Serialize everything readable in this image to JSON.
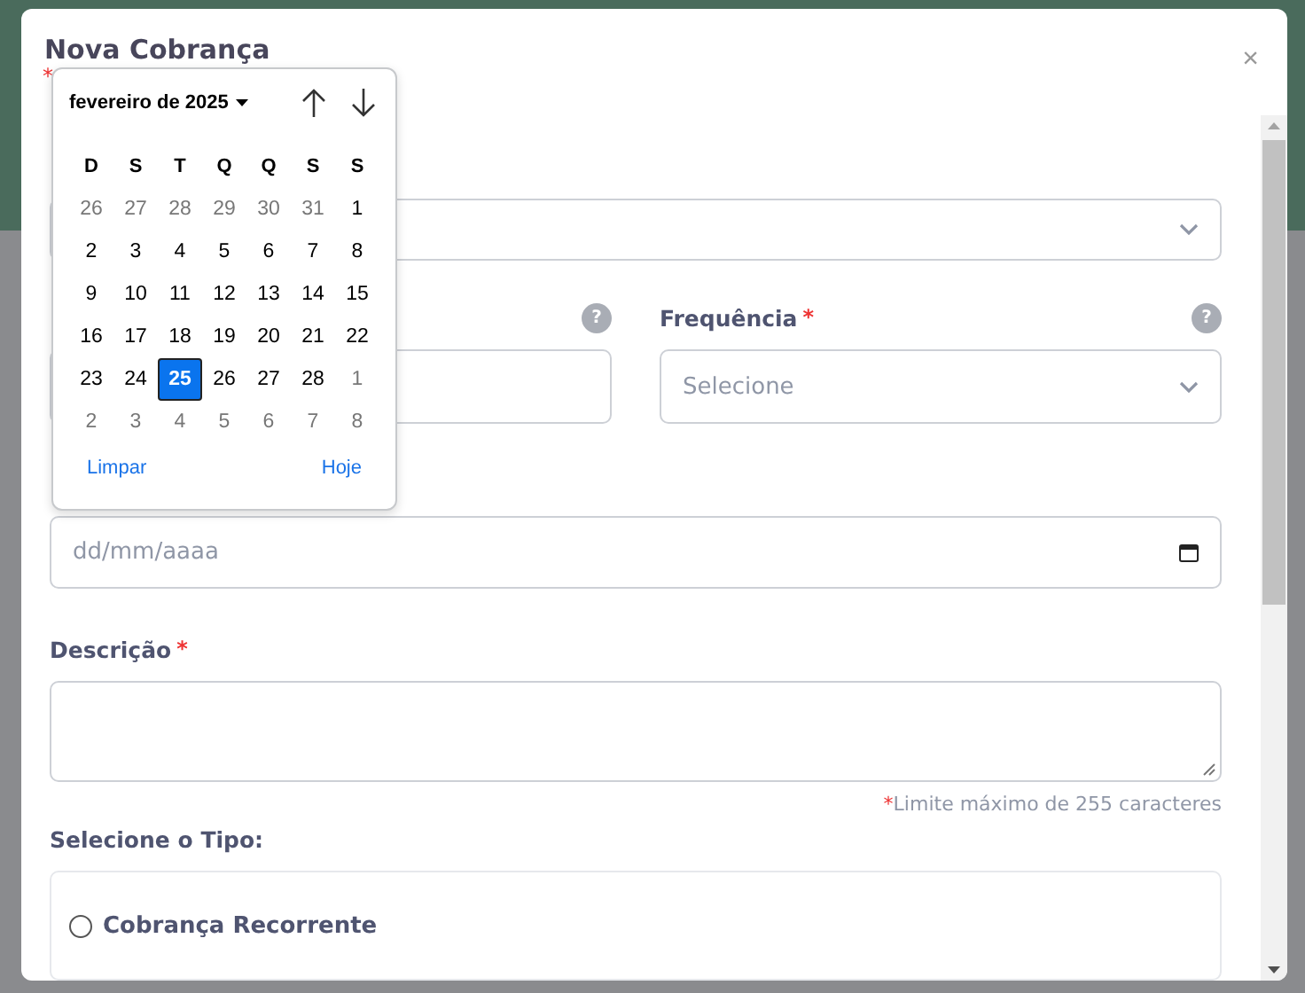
{
  "modal": {
    "title": "Nova Cobrança",
    "required_note": "*",
    "close": "×"
  },
  "fields": [
    {
      "kind": "select"
    },
    {
      "kind": "row",
      "children": [
        {
          "kind": "input",
          "help": "?"
        },
        {
          "kind": "select",
          "label": "Frequência",
          "required_mark": "*",
          "help": "?",
          "value": "Selecione"
        }
      ]
    },
    {
      "kind": "date",
      "placeholder": "dd/mm/aaaa"
    },
    {
      "kind": "textarea",
      "label": "Descrição",
      "required_mark": "*",
      "hint": "Limite máximo de 255 caracteres",
      "hint_mark": "*"
    }
  ],
  "type_section": {
    "label": "Selecione o Tipo:",
    "options": [
      {
        "label": "Cobrança Recorrente",
        "selected": false
      }
    ]
  },
  "datepicker": {
    "month": "fevereiro de 2025",
    "weekdays": [
      "D",
      "S",
      "T",
      "Q",
      "Q",
      "S",
      "S"
    ],
    "weeks": [
      [
        {
          "day": "26",
          "muted": true,
          "selected": false
        },
        {
          "day": "27",
          "muted": true,
          "selected": false
        },
        {
          "day": "28",
          "muted": true,
          "selected": false
        },
        {
          "day": "29",
          "muted": true,
          "selected": false
        },
        {
          "day": "30",
          "muted": true,
          "selected": false
        },
        {
          "day": "31",
          "muted": true,
          "selected": false
        },
        {
          "day": "1",
          "muted": false,
          "selected": false
        }
      ],
      [
        {
          "day": "2",
          "muted": false,
          "selected": false
        },
        {
          "day": "3",
          "muted": false,
          "selected": false
        },
        {
          "day": "4",
          "muted": false,
          "selected": false
        },
        {
          "day": "5",
          "muted": false,
          "selected": false
        },
        {
          "day": "6",
          "muted": false,
          "selected": false
        },
        {
          "day": "7",
          "muted": false,
          "selected": false
        },
        {
          "day": "8",
          "muted": false,
          "selected": false
        }
      ],
      [
        {
          "day": "9",
          "muted": false,
          "selected": false
        },
        {
          "day": "10",
          "muted": false,
          "selected": false
        },
        {
          "day": "11",
          "muted": false,
          "selected": false
        },
        {
          "day": "12",
          "muted": false,
          "selected": false
        },
        {
          "day": "13",
          "muted": false,
          "selected": false
        },
        {
          "day": "14",
          "muted": false,
          "selected": false
        },
        {
          "day": "15",
          "muted": false,
          "selected": false
        }
      ],
      [
        {
          "day": "16",
          "muted": false,
          "selected": false
        },
        {
          "day": "17",
          "muted": false,
          "selected": false
        },
        {
          "day": "18",
          "muted": false,
          "selected": false
        },
        {
          "day": "19",
          "muted": false,
          "selected": false
        },
        {
          "day": "20",
          "muted": false,
          "selected": false
        },
        {
          "day": "21",
          "muted": false,
          "selected": false
        },
        {
          "day": "22",
          "muted": false,
          "selected": false
        }
      ],
      [
        {
          "day": "23",
          "muted": false,
          "selected": false
        },
        {
          "day": "24",
          "muted": false,
          "selected": false
        },
        {
          "day": "25",
          "muted": false,
          "selected": true
        },
        {
          "day": "26",
          "muted": false,
          "selected": false
        },
        {
          "day": "27",
          "muted": false,
          "selected": false
        },
        {
          "day": "28",
          "muted": false,
          "selected": false
        },
        {
          "day": "1",
          "muted": true,
          "selected": false
        }
      ],
      [
        {
          "day": "2",
          "muted": true,
          "selected": false
        },
        {
          "day": "3",
          "muted": true,
          "selected": false
        },
        {
          "day": "4",
          "muted": true,
          "selected": false
        },
        {
          "day": "5",
          "muted": true,
          "selected": false
        },
        {
          "day": "6",
          "muted": true,
          "selected": false
        },
        {
          "day": "7",
          "muted": true,
          "selected": false
        },
        {
          "day": "8",
          "muted": true,
          "selected": false
        }
      ]
    ],
    "clear": "Limpar",
    "today": "Hoje"
  }
}
